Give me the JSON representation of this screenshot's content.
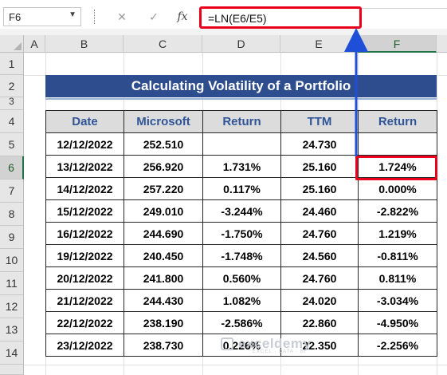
{
  "formula_bar": {
    "name_box": "F6",
    "cancel_icon": "✕",
    "enter_icon": "✓",
    "fx_label": "fx",
    "formula": "=LN(E6/E5)"
  },
  "columns": [
    "A",
    "B",
    "C",
    "D",
    "E",
    "F"
  ],
  "rows": [
    "1",
    "2",
    "3",
    "4",
    "5",
    "6",
    "7",
    "8",
    "9",
    "10",
    "11",
    "12",
    "13",
    "14"
  ],
  "selected_cell": "F6",
  "title": "Calculating Volatility of a Portfolio",
  "table": {
    "headers": [
      "Date",
      "Microsoft",
      "Return",
      "TTM",
      "Return"
    ],
    "rows": [
      [
        "12/12/2022",
        "252.510",
        "",
        "24.730",
        ""
      ],
      [
        "13/12/2022",
        "256.920",
        "1.731%",
        "25.160",
        "1.724%"
      ],
      [
        "14/12/2022",
        "257.220",
        "0.117%",
        "25.160",
        "0.000%"
      ],
      [
        "15/12/2022",
        "249.010",
        "-3.244%",
        "24.460",
        "-2.822%"
      ],
      [
        "16/12/2022",
        "244.690",
        "-1.750%",
        "24.760",
        "1.219%"
      ],
      [
        "19/12/2022",
        "240.450",
        "-1.748%",
        "24.560",
        "-0.811%"
      ],
      [
        "20/12/2022",
        "241.800",
        "0.560%",
        "24.760",
        "0.811%"
      ],
      [
        "21/12/2022",
        "244.430",
        "1.082%",
        "24.020",
        "-3.034%"
      ],
      [
        "22/12/2022",
        "238.190",
        "-2.586%",
        "22.860",
        "-4.950%"
      ],
      [
        "23/12/2022",
        "238.730",
        "0.226%",
        "22.350",
        "-2.256%"
      ]
    ]
  },
  "watermark": {
    "brand": "exceldemy",
    "tagline": "EXCEL · DATA · BI"
  },
  "colors": {
    "title_bg": "#2e4d8e",
    "header_text": "#2f5597",
    "highlight": "#e8001c",
    "arrow": "#1f4fd8",
    "excel_green": "#217346"
  }
}
